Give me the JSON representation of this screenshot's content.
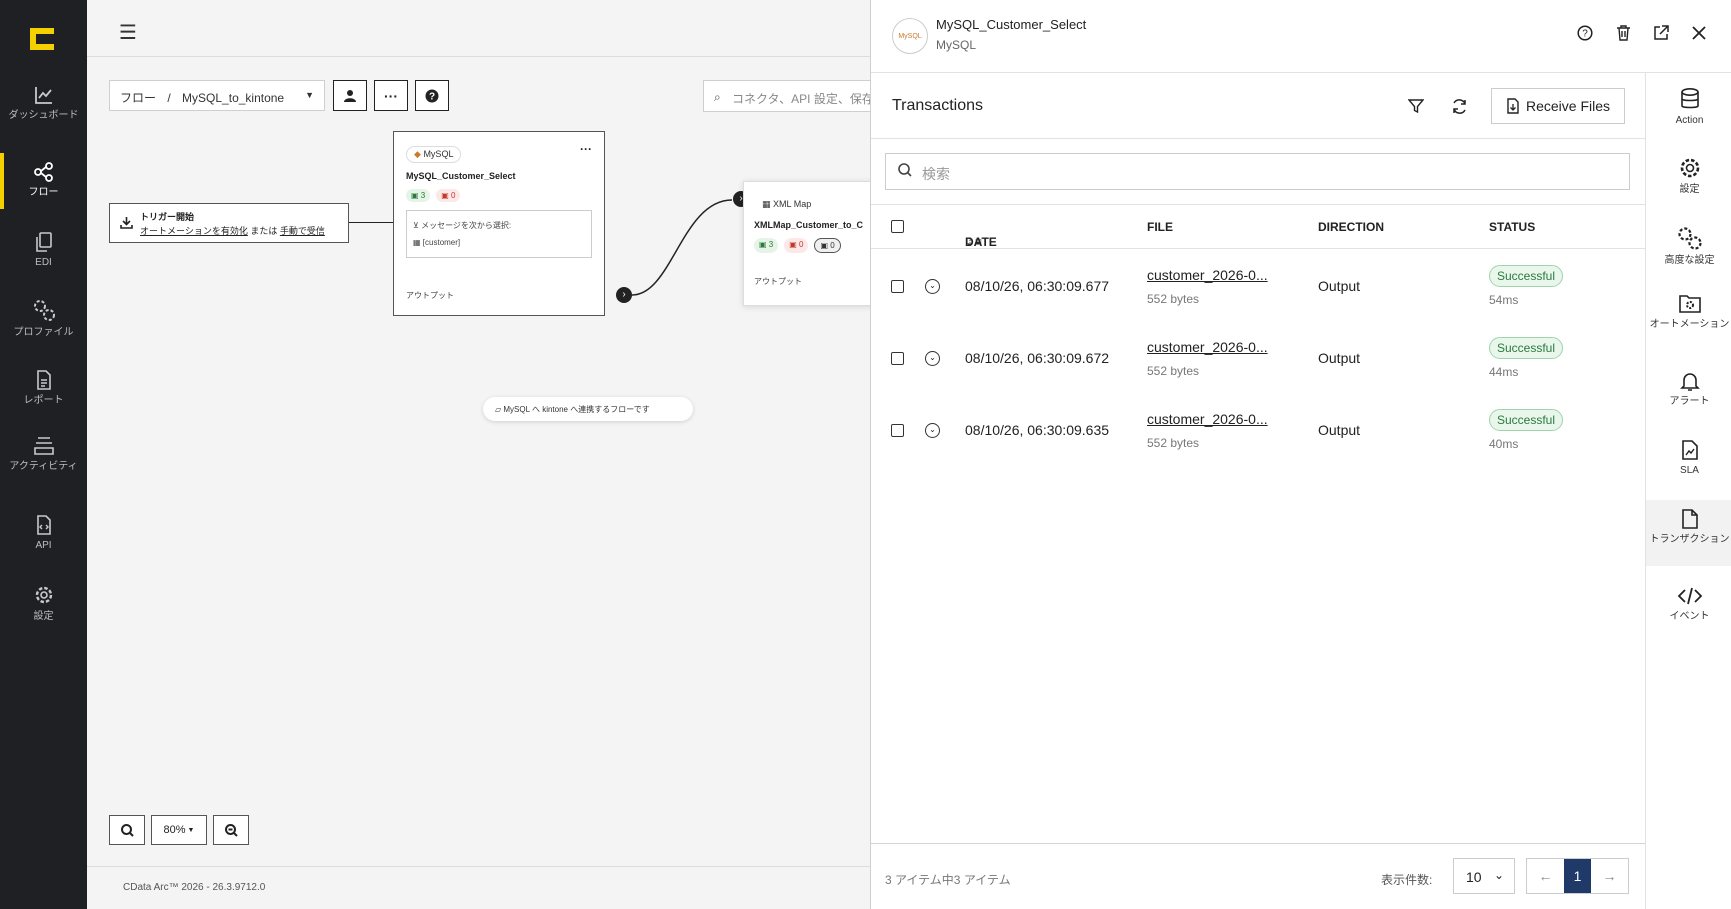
{
  "app": {
    "name": "CData Arc",
    "version": "CData Arc™ 2026 - 26.3.9712.0",
    "accent": "#f5d000"
  },
  "nav": {
    "items": [
      {
        "label": "ダッシュボード",
        "icon": "chart-line-icon"
      },
      {
        "label": "フロー",
        "icon": "share-nodes-icon",
        "active": true
      },
      {
        "label": "EDI",
        "icon": "documents-icon"
      },
      {
        "label": "プロファイル",
        "icon": "gears-icon"
      },
      {
        "label": "レポート",
        "icon": "report-icon"
      },
      {
        "label": "アクティビティ",
        "icon": "layers-icon"
      },
      {
        "label": "API",
        "icon": "api-file-icon"
      },
      {
        "label": "設定",
        "icon": "gear-icon"
      }
    ]
  },
  "canvas": {
    "breadcrumb_root": "フロー",
    "breadcrumb_sep": "/",
    "breadcrumb_flow": "MySQL_to_kintone",
    "search_placeholder": "コネクタ、API 設定、保存",
    "trigger": {
      "title": "トリガー開始",
      "link1": "オートメーションを有効化",
      "or": "または",
      "link2": "手動で受信"
    },
    "node1": {
      "tag": "MySQL",
      "title": "MySQL_Customer_Select",
      "success": "3",
      "error": "0",
      "msg_label": "メッセージを次から選択:",
      "msg_value": "[customer]",
      "output": "アウトプット"
    },
    "node2": {
      "tag": "XML Map",
      "title": "XMLMap_Customer_to_C",
      "success": "3",
      "error": "0",
      "other": "0",
      "output": "アウトプット"
    },
    "note": "MySQL へ kintone へ連携するフローです",
    "zoom_level": "80%"
  },
  "panel": {
    "connector_name": "MySQL_Customer_Select",
    "connector_type": "MySQL",
    "avatar_text": "MySQL",
    "title": "Transactions",
    "receive_label": "Receive Files",
    "search_placeholder": "検索",
    "columns": {
      "date": "DATE",
      "file": "FILE",
      "direction": "DIRECTION",
      "status": "STATUS"
    },
    "rows": [
      {
        "date": "08/10/26, 06:30:09.677",
        "file": "customer_2026-0...",
        "size": "552 bytes",
        "direction": "Output",
        "status": "Successful",
        "duration": "54ms"
      },
      {
        "date": "08/10/26, 06:30:09.672",
        "file": "customer_2026-0...",
        "size": "552 bytes",
        "direction": "Output",
        "status": "Successful",
        "duration": "44ms"
      },
      {
        "date": "08/10/26, 06:30:09.635",
        "file": "customer_2026-0...",
        "size": "552 bytes",
        "direction": "Output",
        "status": "Successful",
        "duration": "40ms"
      }
    ],
    "footer_count": "3 アイテム中3 アイテム",
    "per_page_label": "表示件数:",
    "per_page_value": "10",
    "current_page": "1"
  },
  "rail": {
    "items": [
      {
        "label": "Action",
        "icon": "database-icon"
      },
      {
        "label": "設定",
        "icon": "gear-icon"
      },
      {
        "label": "高度な設定",
        "icon": "gears-icon"
      },
      {
        "label": "オートメーション",
        "icon": "folder-gear-icon"
      },
      {
        "label": "アラート",
        "icon": "bell-icon"
      },
      {
        "label": "SLA",
        "icon": "sla-file-icon"
      },
      {
        "label": "トランザクション",
        "icon": "file-icon",
        "active": true
      },
      {
        "label": "イベント",
        "icon": "code-icon"
      }
    ]
  }
}
